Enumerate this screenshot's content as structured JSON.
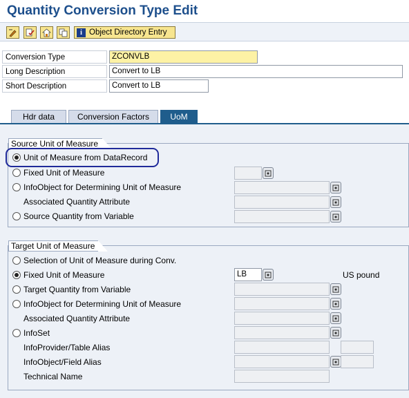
{
  "window": {
    "title": "Quantity Conversion Type Edit"
  },
  "toolbar": {
    "icons": [
      "display-change-icon",
      "check-icon",
      "activate-icon",
      "copy-icon"
    ],
    "object_directory_label": "Object Directory Entry"
  },
  "header_fields": {
    "conversion_type_label": "Conversion Type",
    "conversion_type_value": "ZCONVLB",
    "long_description_label": "Long Description",
    "long_description_value": "Convert to LB",
    "short_description_label": "Short Description",
    "short_description_value": "Convert to LB"
  },
  "tabs": [
    {
      "label": "Hdr data",
      "active": false
    },
    {
      "label": "Conversion Factors",
      "active": false
    },
    {
      "label": "UoM",
      "active": true
    }
  ],
  "source_group": {
    "title": "Source Unit of Measure",
    "options": {
      "from_datarecord": "Unit of Measure from DataRecord",
      "fixed_unit": "Fixed Unit of Measure",
      "infoobject_unit": "InfoObject for Determining Unit of Measure",
      "associated_attr": "Associated Quantity Attribute",
      "source_qty_var": "Source Quantity from Variable"
    },
    "selected": "from_datarecord"
  },
  "target_group": {
    "title": "Target Unit of Measure",
    "options": {
      "selection_during_conv": "Selection of Unit of Measure during Conv.",
      "fixed_unit": "Fixed Unit of Measure",
      "target_qty_var": "Target Quantity from Variable",
      "infoobject_unit": "InfoObject for Determining Unit of Measure",
      "associated_attr": "Associated Quantity Attribute",
      "infoset": "InfoSet",
      "infoprovider_alias": "InfoProvider/Table Alias",
      "infoobject_alias": "InfoObject/Field Alias",
      "technical_name": "Technical Name"
    },
    "fixed_unit_value": "LB",
    "fixed_unit_text": "US pound",
    "selected": "fixed_unit"
  },
  "colors": {
    "title": "#1d4f8c",
    "tab_active": "#1f5d8c",
    "required_field": "#fdf2a5",
    "highlight": "#1f2a9a"
  }
}
